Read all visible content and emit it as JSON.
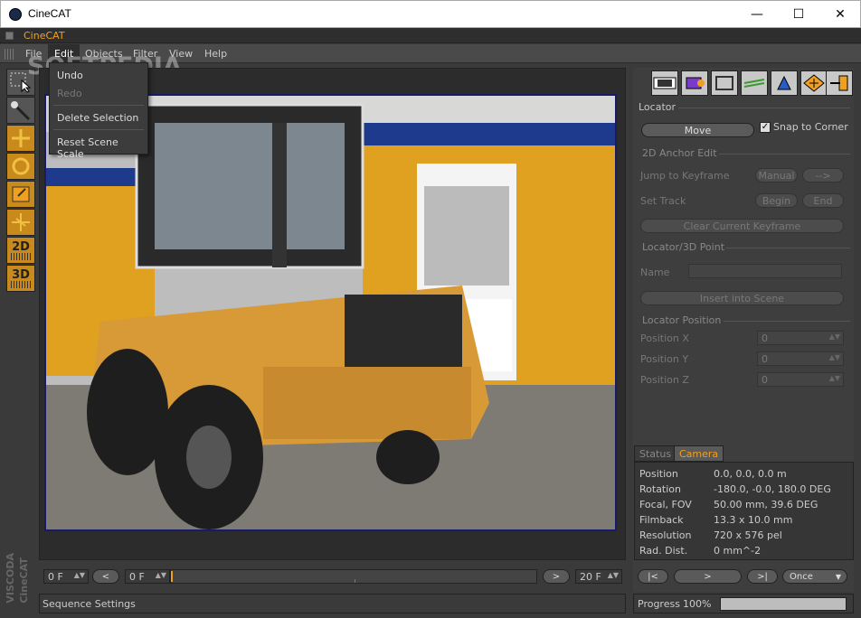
{
  "window": {
    "title": "CineCAT",
    "minimize": "—",
    "maximize": "☐",
    "close": "✕"
  },
  "tab_title": "CineCAT",
  "menu": [
    "File",
    "Edit",
    "Objects",
    "Filter",
    "View",
    "Help"
  ],
  "watermark": "SOFTPEDIA",
  "edit_menu": {
    "items": [
      "Undo",
      "Redo",
      "Delete Selection",
      "Reset Scene Scale"
    ],
    "disabled": [
      "Redo"
    ]
  },
  "left_tools": [
    "selection-tool-icon",
    "magic-wand-icon",
    "move-icon",
    "rotate-icon",
    "scale-icon",
    "snap-icon",
    "2d-grid",
    "3d-grid"
  ],
  "tool_labels": {
    "2d": "2D",
    "3d": "3D"
  },
  "viscoda": "VISCODA\nCineCAT",
  "right_tools": [
    "film-icon",
    "camera-icon",
    "crop-icon",
    "track-icon",
    "locator-icon",
    "move-diamond-icon",
    "exit-icon"
  ],
  "locator": {
    "title": "Locator",
    "move_button": "Move",
    "snap_label": "Snap to Corner",
    "anchor_title": "2D Anchor Edit",
    "jump_label": "Jump to Keyframe",
    "manual_button": "Manual",
    "arrow_button": "-->",
    "set_track_label": "Set Track",
    "begin_button": "Begin",
    "end_button": "End",
    "clear_button": "Clear Current Keyframe",
    "point_title": "Locator/3D Point",
    "name_label": "Name",
    "name_value": "",
    "insert_button": "Insert into Scene",
    "position_title": "Locator Position",
    "pos_x_label": "Position X",
    "pos_y_label": "Position Y",
    "pos_z_label": "Position Z",
    "pos_x": "0",
    "pos_y": "0",
    "pos_z": "0"
  },
  "camera_tabs": {
    "status": "Status",
    "camera": "Camera"
  },
  "camera": {
    "rows": [
      {
        "key": "Position",
        "value": "0.0, 0.0, 0.0 m"
      },
      {
        "key": "Rotation",
        "value": "-180.0, -0.0, 180.0 DEG"
      },
      {
        "key": "Focal, FOV",
        "value": "50.00 mm, 39.6 DEG"
      },
      {
        "key": "Filmback",
        "value": "13.3 x 10.0 mm"
      },
      {
        "key": "Resolution",
        "value": "720 x 576 pel"
      },
      {
        "key": "Rad. Dist.",
        "value": "0 mm^-2"
      }
    ]
  },
  "timeline": {
    "start": "0 F",
    "current": "0 F",
    "end": "20 F",
    "prev": "<",
    "next": ">"
  },
  "playback": {
    "first": "|<",
    "play": ">",
    "last": ">|",
    "mode": "Once"
  },
  "status_text": "Sequence Settings",
  "progress": {
    "label": "Progress",
    "value": "100%",
    "fraction": 1.0
  }
}
